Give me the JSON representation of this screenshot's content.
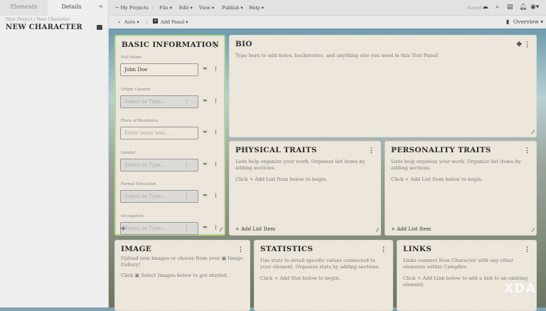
{
  "sidebar": {
    "tabs": [
      "Elements",
      "Details"
    ],
    "collapse": "«",
    "breadcrumb": "New Project / New Character",
    "title": "NEW CHARACTER"
  },
  "topbar": {
    "back": "← My Projects",
    "menus": [
      "File ▾",
      "Edit ▾",
      "View ▾",
      "Publish ▾",
      "Help ▾"
    ],
    "saved": "Saved"
  },
  "toolbar": {
    "zoom": "Auto ▾",
    "add_panel": "Add Panel ▾",
    "overview": "Overview ▾"
  },
  "basic": {
    "title": "BASIC INFORMATION",
    "fields": [
      {
        "label": "Full Name",
        "value": "John Doe",
        "type": "text"
      },
      {
        "label": "Origin Country",
        "value": "Select or Type...",
        "type": "select"
      },
      {
        "label": "Place of Residence",
        "value": "Enter some text...",
        "type": "text-empty"
      },
      {
        "label": "Gender",
        "value": "Select or Type...",
        "type": "select"
      },
      {
        "label": "Formal Education",
        "value": "Select or Type...",
        "type": "select"
      },
      {
        "label": "Occupation",
        "value": "Select or Type...",
        "type": "select"
      }
    ]
  },
  "bio": {
    "title": "BIO",
    "placeholder": "Type here to add notes, backstories, and anything else you need in this Text Panel!"
  },
  "physical": {
    "title": "PHYSICAL TRAITS",
    "text": "Lists help organize your work. Organize list items by adding sections.",
    "hint": "Click + Add List Item below to begin.",
    "add": "+ Add List Item"
  },
  "personality": {
    "title": "PERSONALITY TRAITS",
    "text": "Lists help organize your work. Organize list items by adding sections.",
    "hint": "Click + Add List Item below to begin.",
    "add": "+ Add List Item"
  },
  "image": {
    "title": "IMAGE",
    "text": "Upload new images or choose from your ▣ Image Gallery!",
    "hint": "Click ▣ Select Images below to get started."
  },
  "statistics": {
    "title": "STATISTICS",
    "text": "Use stats to detail specific values connected to your element. Organize stats by adding sections.",
    "hint": "Click + Add Stat below to begin."
  },
  "links": {
    "title": "LINKS",
    "text": "Links connect New Character with any other elements within Campfire.",
    "hint": "Click + Add Link below to add a link to an existing element."
  },
  "watermark": "XDA"
}
